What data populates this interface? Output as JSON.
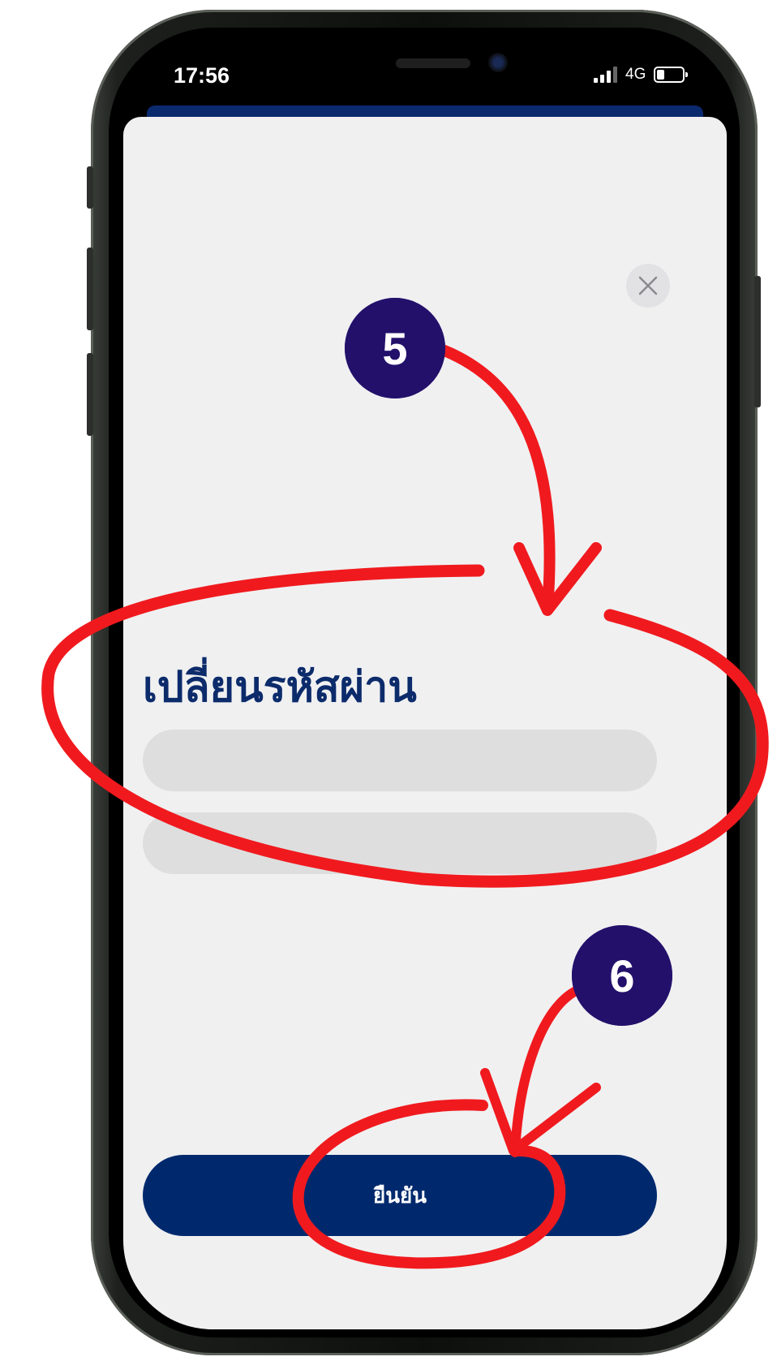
{
  "status_bar": {
    "time": "17:56",
    "network": "4G"
  },
  "sheet": {
    "title": "เปลี่ยนรหัสผ่าน",
    "fields": [
      {
        "value": "",
        "placeholder": ""
      },
      {
        "value": "",
        "placeholder": ""
      }
    ],
    "confirm_label": "ยืนยัน"
  },
  "annotations": {
    "step_a": "5",
    "step_b": "6",
    "mark_color": "#f01a1e",
    "badge_color": "#23106b"
  },
  "colors": {
    "brand_navy": "#00296d",
    "title_navy": "#0c2b6b",
    "sheet_background": "#f0f0f1",
    "field_background": "#dedede"
  }
}
